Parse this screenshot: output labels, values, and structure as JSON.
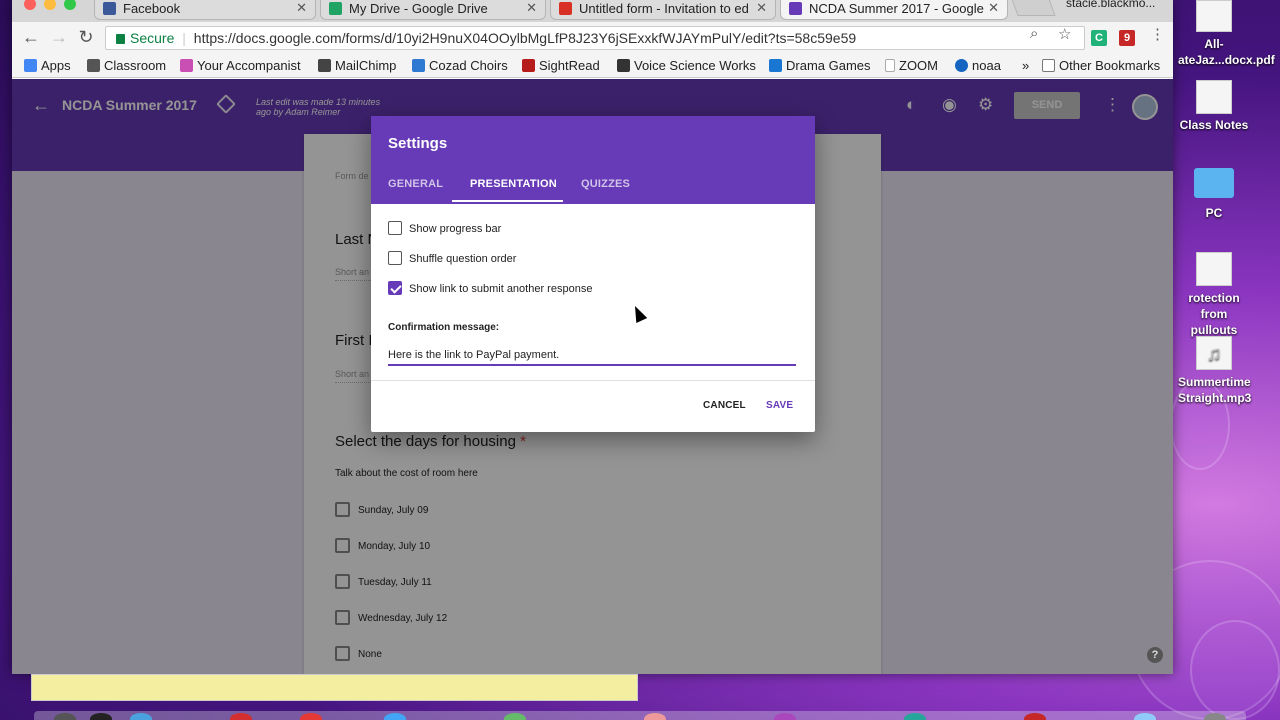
{
  "browser": {
    "tabs": [
      {
        "title": "Facebook",
        "icon": "facebook-icon",
        "color": "#3b5998"
      },
      {
        "title": "My Drive - Google Drive",
        "icon": "drive-icon",
        "color": "#1fa463"
      },
      {
        "title": "Untitled form - Invitation to ed",
        "icon": "gmail-icon",
        "color": "#d93025"
      },
      {
        "title": "NCDA Summer 2017 - Google",
        "icon": "forms-icon",
        "color": "#673ab7"
      }
    ],
    "profile_name": "stacie.blackmo...",
    "secure_label": "Secure",
    "url": "https://docs.google.com/forms/d/10yi2H9nuX04OOylbMgLfP8J23Y6jSExxkfWJAYmPulY/edit?ts=58c59e59"
  },
  "bookmarks": [
    {
      "label": "Apps",
      "icon": "apps-grid-icon",
      "color": "#4285f4"
    },
    {
      "label": "Classroom",
      "icon": "classroom-icon",
      "color": "#555"
    },
    {
      "label": "Your Accompanist",
      "icon": "wifi-icon",
      "color": "#c94fb4"
    },
    {
      "label": "MailChimp",
      "icon": "mailchimp-icon",
      "color": "#444"
    },
    {
      "label": "Cozad Choirs",
      "icon": "w-icon",
      "color": "#2d78d0"
    },
    {
      "label": "SightRead",
      "icon": "sightread-icon",
      "color": "#b71c1c"
    },
    {
      "label": "Voice Science Works",
      "icon": "shield-icon",
      "color": "#333"
    },
    {
      "label": "Drama Games",
      "icon": "drama-icon",
      "color": "#1976d2"
    },
    {
      "label": "ZOOM",
      "icon": "page-icon",
      "color": "#aaa"
    },
    {
      "label": "noaa",
      "icon": "noaa-icon",
      "color": "#1565c0"
    },
    {
      "label": "Other Bookmarks",
      "icon": "folder-icon",
      "color": "#777"
    }
  ],
  "forms": {
    "title": "NCDA Summer 2017",
    "last_edit": "Last edit was made 13 minutes ago by Adam Reimer",
    "send_label": "SEND",
    "form_desc_hint": "Form de",
    "questions": [
      {
        "title": "Last N",
        "hint": "Short an"
      },
      {
        "title": "First I",
        "hint": "Short an"
      }
    ],
    "housing_question": {
      "title": "Select the days for housing",
      "required_mark": "*",
      "description": "Talk about the cost of room here",
      "options": [
        "Sunday, July 09",
        "Monday, July 10",
        "Tuesday, July 11",
        "Wednesday, July 12",
        "None"
      ]
    },
    "help_label": "?"
  },
  "dialog": {
    "title": "Settings",
    "tabs": [
      "GENERAL",
      "PRESENTATION",
      "QUIZZES"
    ],
    "active_tab": "PRESENTATION",
    "options": [
      {
        "label": "Show progress bar",
        "checked": false
      },
      {
        "label": "Shuffle question order",
        "checked": false
      },
      {
        "label": "Show link to submit another response",
        "checked": true
      }
    ],
    "confirmation_label": "Confirmation message:",
    "confirmation_value": "Here is the link to PayPal payment.",
    "cancel_label": "CANCEL",
    "save_label": "SAVE",
    "accent": "#673ab7"
  },
  "desktop": {
    "icons": [
      {
        "label": "All-\nateJaz...docx.pdf"
      },
      {
        "label": "Class Notes"
      },
      {
        "label": "PC"
      },
      {
        "label": "rotection from pullouts"
      },
      {
        "label": "Summertime Straight.mp3"
      }
    ]
  }
}
